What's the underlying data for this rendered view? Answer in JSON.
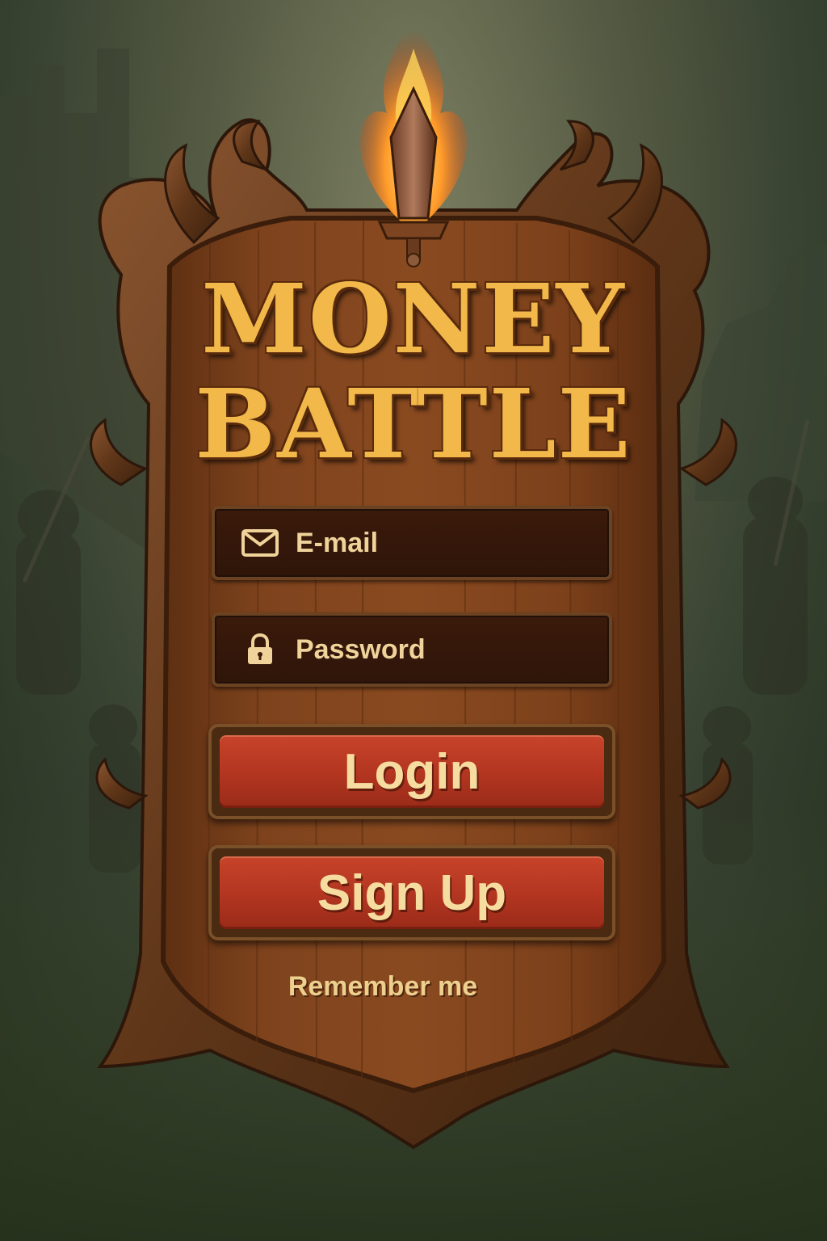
{
  "logo": {
    "line1": "MONEY",
    "line2": "BATTLE",
    "icon": "flaming-sword-icon"
  },
  "login_form": {
    "email": {
      "placeholder": "E-mail",
      "icon": "envelope-icon"
    },
    "password": {
      "placeholder": "Password",
      "icon": "padlock-icon"
    },
    "login_button": "Login",
    "signup_button": "Sign Up",
    "remember_me": "Remember me"
  },
  "colors": {
    "title_gold": "#f2b84a",
    "button_red": "#b23520",
    "field_dark": "#2f1509",
    "wood": "#7a421c"
  }
}
